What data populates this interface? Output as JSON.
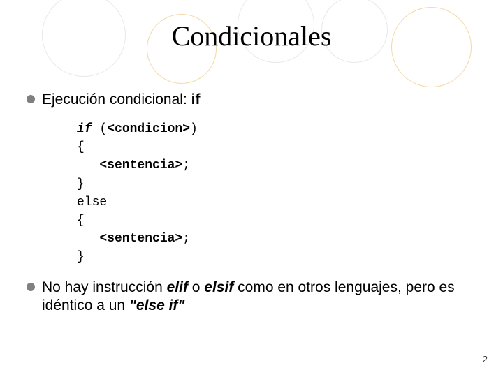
{
  "title": "Condicionales",
  "bullet1": {
    "prefix": "Ejecución condicional: ",
    "keyword": "if"
  },
  "code": {
    "l1_kw": "if",
    "l1_rest": " (",
    "l1_param": "<condicion>",
    "l1_close": ")",
    "l2": "{",
    "l3_indent": "   ",
    "l3_param": "<sentencia>",
    "l3_semi": ";",
    "l4": "}",
    "l5": "else",
    "l6": "{",
    "l7_indent": "   ",
    "l7_param": "<sentencia>",
    "l7_semi": ";",
    "l8": "}"
  },
  "bullet2": {
    "p1": "No hay instrucción ",
    "kw1": "elif",
    "p2": " o ",
    "kw2": "elsif",
    "p3": " como en otros lenguajes, pero es idéntico a un ",
    "quoted": "\"else if\""
  },
  "pageNumber": "2"
}
